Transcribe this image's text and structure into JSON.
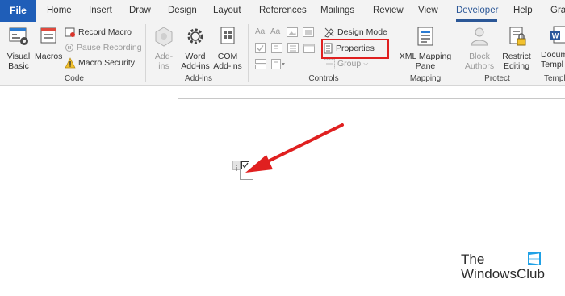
{
  "tabs": {
    "file": "File",
    "home": "Home",
    "insert": "Insert",
    "draw": "Draw",
    "design": "Design",
    "layout": "Layout",
    "references": "References",
    "mailings": "Mailings",
    "review": "Review",
    "view": "View",
    "developer": "Developer",
    "help": "Help",
    "gra": "Gra"
  },
  "code": {
    "label": "Code",
    "visual_basic_1": "Visual",
    "visual_basic_2": "Basic",
    "macros": "Macros",
    "record_macro": "Record Macro",
    "pause_recording": "Pause Recording",
    "macro_security": "Macro Security"
  },
  "addins": {
    "label": "Add-ins",
    "addins_1": "Add-",
    "addins_2": "ins",
    "word_1": "Word",
    "word_2": "Add-ins",
    "com_1": "COM",
    "com_2": "Add-ins"
  },
  "controls": {
    "label": "Controls",
    "design_mode": "Design Mode",
    "properties": "Properties",
    "group": "Group"
  },
  "mapping": {
    "label": "Mapping",
    "xml_1": "XML Mapping",
    "xml_2": "Pane"
  },
  "protect": {
    "label": "Protect",
    "block_1": "Block",
    "block_2": "Authors",
    "restrict_1": "Restrict",
    "restrict_2": "Editing"
  },
  "templates": {
    "label": "Templ",
    "doc_1": "Docum",
    "doc_2": "Templ"
  },
  "watermark": {
    "line1": "The",
    "line2": "WindowsClub"
  },
  "colors": {
    "accent": "#2b5797",
    "file_tab": "#1f5eb8",
    "highlight": "#e02020",
    "ribbon_bg": "#f3f3f3"
  }
}
